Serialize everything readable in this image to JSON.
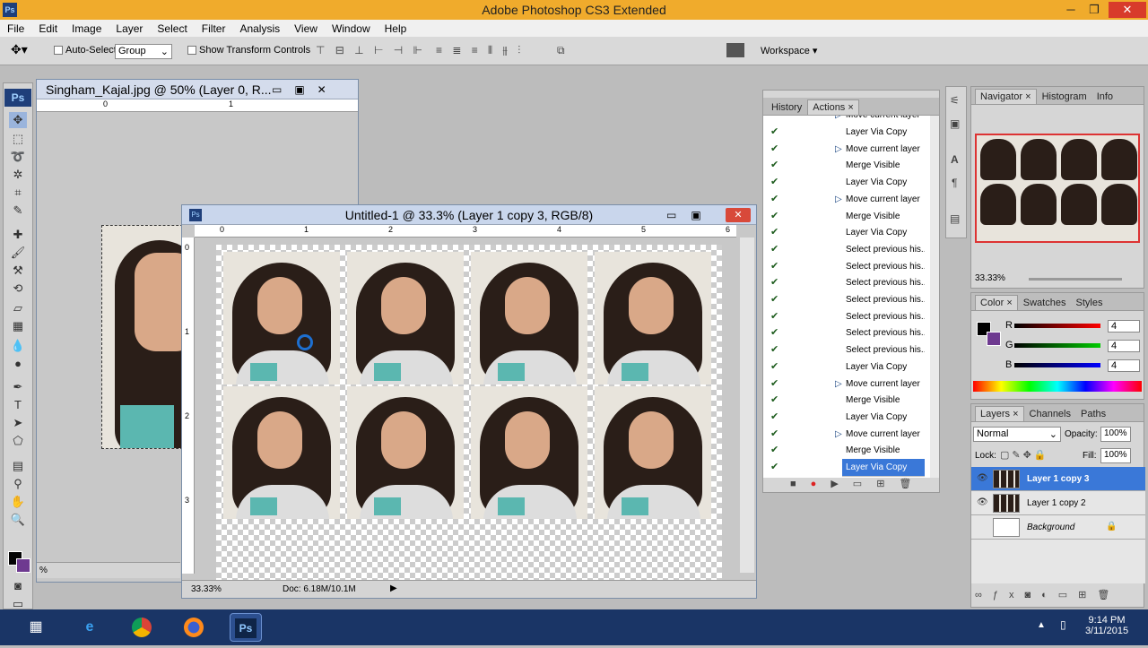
{
  "app": {
    "title": "Adobe Photoshop CS3 Extended",
    "logo": "Ps",
    "win_min": "─",
    "win_max": "❐",
    "win_close": "✕"
  },
  "menu": [
    "File",
    "Edit",
    "Image",
    "Layer",
    "Select",
    "Filter",
    "Analysis",
    "View",
    "Window",
    "Help"
  ],
  "options": {
    "auto_select_label": "Auto-Select:",
    "auto_select_value": "Group",
    "show_transform_label": "Show Transform Controls",
    "workspace_label": "Workspace ▾"
  },
  "doc1": {
    "title": "Singham_Kajal.jpg @ 50% (Layer 0, R...",
    "zoom": "%",
    "ruler": [
      "0",
      "1"
    ]
  },
  "doc2": {
    "title": "Untitled-1 @ 33.3% (Layer 1 copy 3, RGB/8)",
    "zoom": "33.33%",
    "doc_info": "Doc: 6.18M/10.1M",
    "ruler_h": [
      "0",
      "1",
      "2",
      "3",
      "4",
      "5",
      "6"
    ],
    "ruler_v": [
      "0",
      "1",
      "2",
      "3"
    ]
  },
  "actions_panel": {
    "tabs": [
      "History",
      "Actions"
    ],
    "rows": [
      {
        "label": "Layer Via Copy",
        "arrow": false
      },
      {
        "label": "Move current layer",
        "arrow": true
      },
      {
        "label": "Merge Visible",
        "arrow": false
      },
      {
        "label": "Layer Via Copy",
        "arrow": false
      },
      {
        "label": "Move current layer",
        "arrow": true
      },
      {
        "label": "Merge Visible",
        "arrow": false
      },
      {
        "label": "Layer Via Copy",
        "arrow": false
      },
      {
        "label": "Select previous his...",
        "arrow": false
      },
      {
        "label": "Select previous his...",
        "arrow": false
      },
      {
        "label": "Select previous his...",
        "arrow": false
      },
      {
        "label": "Select previous his...",
        "arrow": false
      },
      {
        "label": "Select previous his...",
        "arrow": false
      },
      {
        "label": "Select previous his...",
        "arrow": false
      },
      {
        "label": "Select previous his...",
        "arrow": false
      },
      {
        "label": "Layer Via Copy",
        "arrow": false
      },
      {
        "label": "Move current layer",
        "arrow": true
      },
      {
        "label": "Merge Visible",
        "arrow": false
      },
      {
        "label": "Layer Via Copy",
        "arrow": false
      },
      {
        "label": "Move current layer",
        "arrow": true
      },
      {
        "label": "Merge Visible",
        "arrow": false
      },
      {
        "label": "Layer Via Copy",
        "arrow": false,
        "selected": true
      }
    ],
    "partial_row": "Move current layer"
  },
  "navigator": {
    "tabs": [
      "Navigator",
      "Histogram",
      "Info"
    ],
    "zoom": "33.33%"
  },
  "color": {
    "tabs": [
      "Color",
      "Swatches",
      "Styles"
    ],
    "r": "4",
    "g": "4",
    "b": "4",
    "r_label": "R",
    "g_label": "G",
    "b_label": "B"
  },
  "layers": {
    "tabs": [
      "Layers",
      "Channels",
      "Paths"
    ],
    "blend": "Normal",
    "opacity_label": "Opacity:",
    "opacity": "100%",
    "lock_label": "Lock:",
    "fill_label": "Fill:",
    "fill": "100%",
    "items": [
      {
        "name": "Layer 1 copy 3",
        "selected": true
      },
      {
        "name": "Layer 1 copy 2",
        "selected": false
      },
      {
        "name": "Background",
        "selected": false
      }
    ]
  },
  "taskbar": {
    "time": "9:14 PM",
    "date": "3/11/2015"
  }
}
